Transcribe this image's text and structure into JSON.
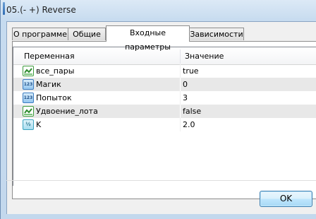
{
  "window": {
    "title": "05.(- +) Reverse"
  },
  "tabs": [
    {
      "label": "О программе",
      "active": false
    },
    {
      "label": "Общие",
      "active": false
    },
    {
      "label": "Входные параметры",
      "active": true
    },
    {
      "label": "Зависимости",
      "active": false
    }
  ],
  "table": {
    "columns": [
      "Переменная",
      "Значение"
    ],
    "rows": [
      {
        "icon": "bool-icon",
        "name": "все_пары",
        "value": "true"
      },
      {
        "icon": "int-123-icon",
        "name": "Магик",
        "value": "0"
      },
      {
        "icon": "int-123-icon",
        "name": "Попыток",
        "value": "3"
      },
      {
        "icon": "bool-icon",
        "name": "Удвоение_лота",
        "value": "false"
      },
      {
        "icon": "double-half-icon",
        "name": "K",
        "value": "2.0"
      }
    ],
    "icon_text": {
      "int": "123",
      "dbl": "½"
    }
  },
  "footer": {
    "ok_label": "OK"
  }
}
